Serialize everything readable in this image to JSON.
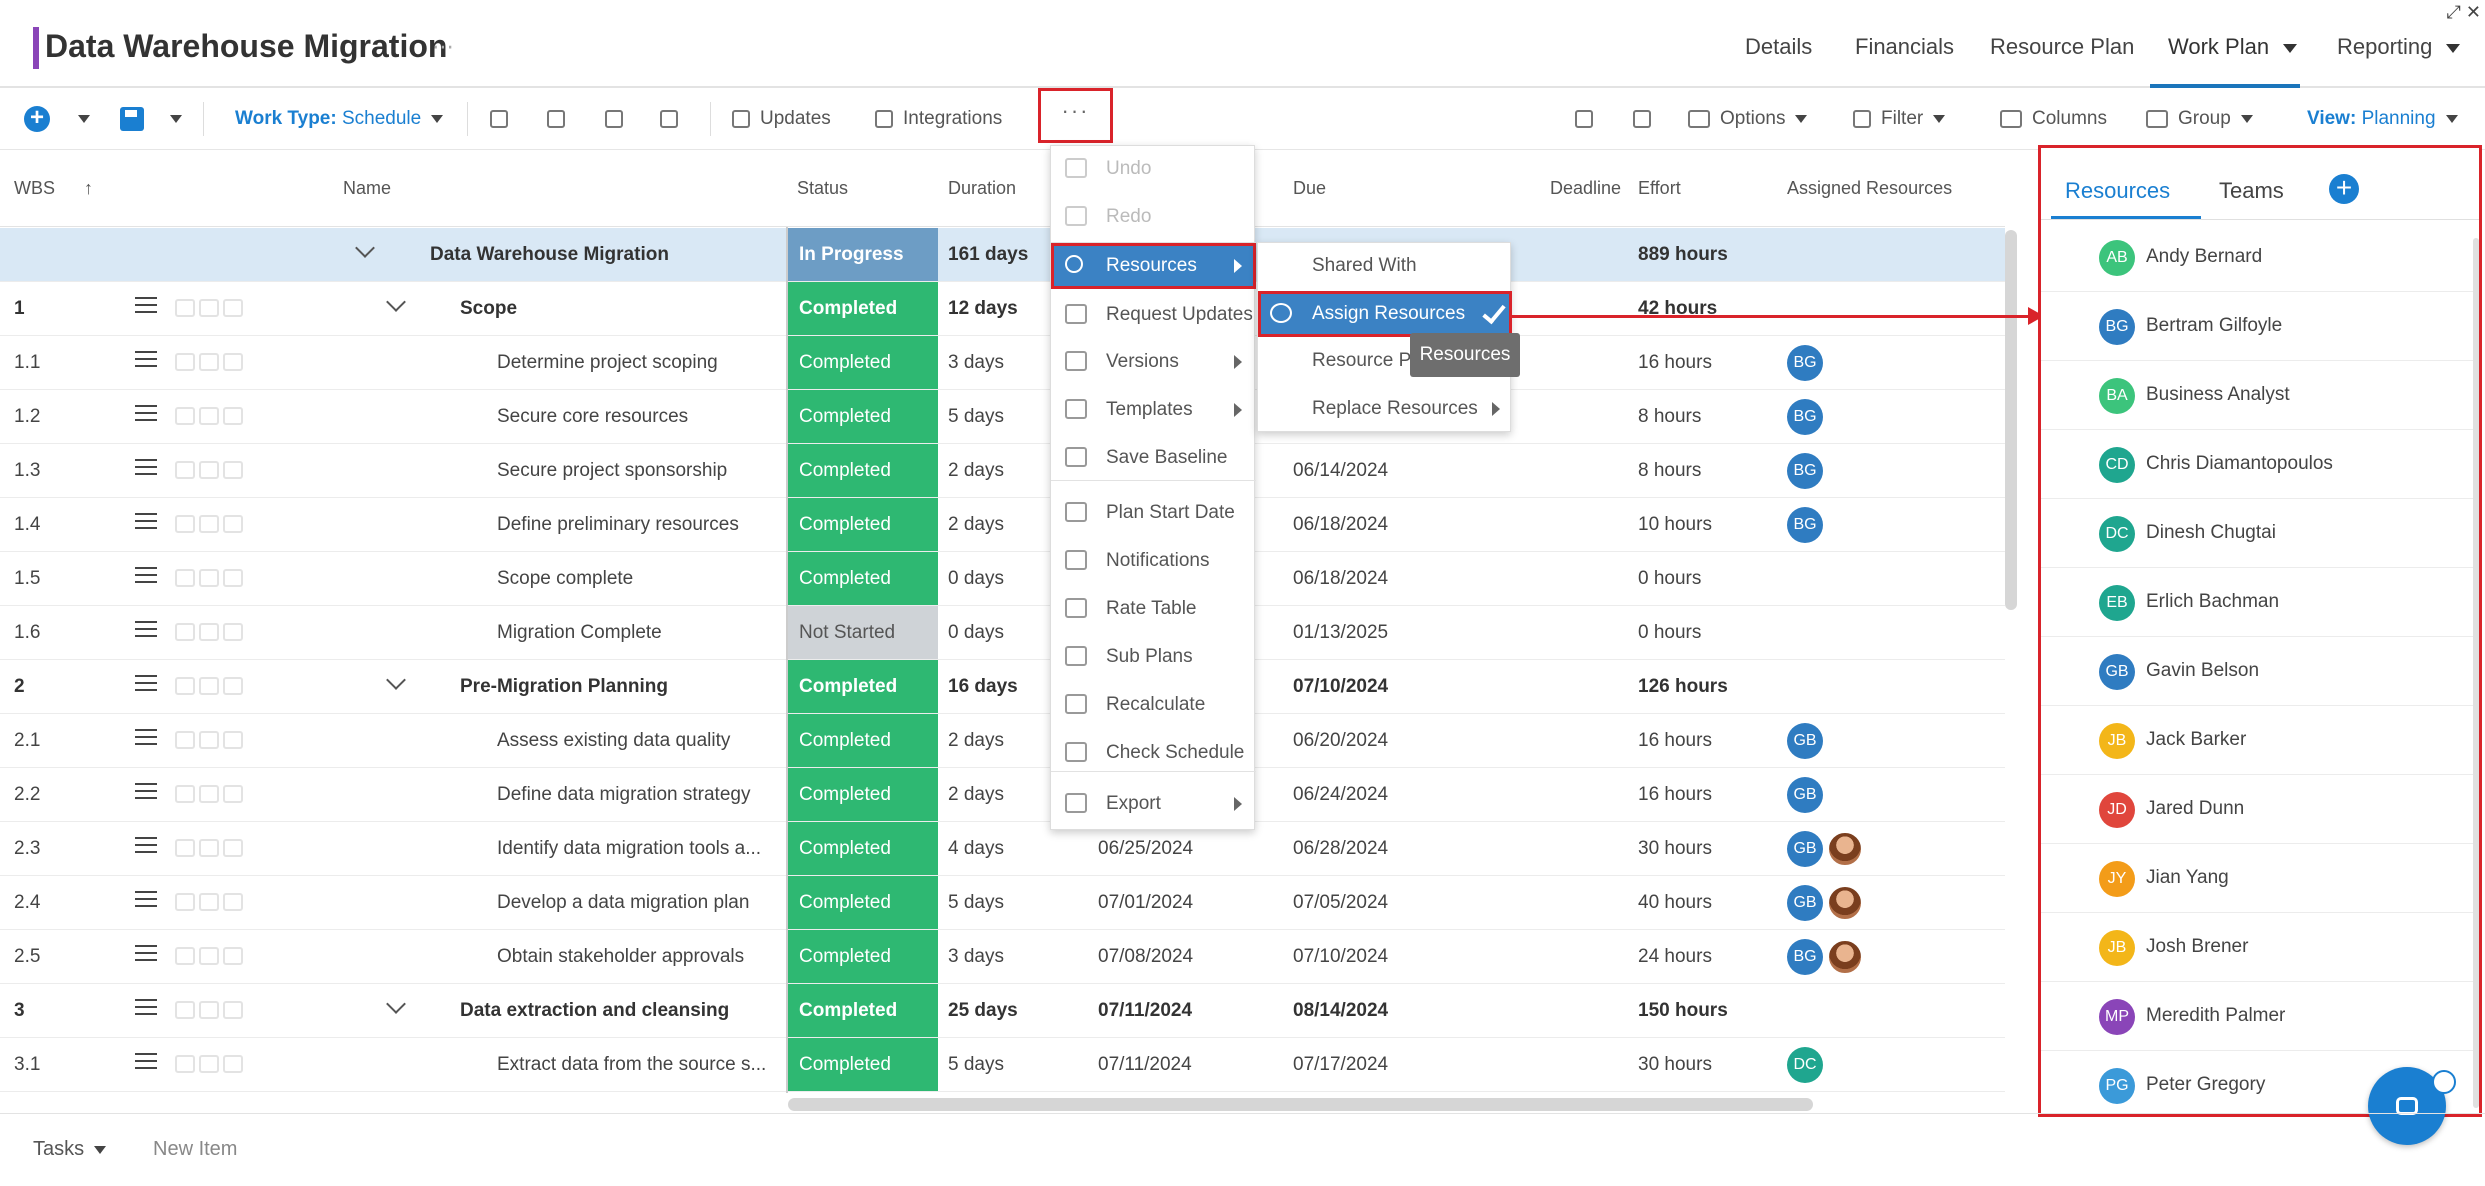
{
  "header": {
    "title": "Data Warehouse Migration",
    "title_more": "⋯",
    "nav": [
      {
        "label": "Details"
      },
      {
        "label": "Financials"
      },
      {
        "label": "Resource Plan"
      },
      {
        "label": "Work Plan"
      },
      {
        "label": "Reporting"
      }
    ],
    "active_nav": "Work Plan",
    "window_icons": "⤢ ✕"
  },
  "toolbar": {
    "work_type_label": "Work Type:",
    "work_type_value": "Schedule",
    "updates": "Updates",
    "integrations": "Integrations",
    "more": "···",
    "options": "Options",
    "filter": "Filter",
    "columns": "Columns",
    "group": "Group",
    "view_label": "View:",
    "view_value": "Planning"
  },
  "grid": {
    "headers": {
      "wbs": "WBS",
      "name": "Name",
      "status": "Status",
      "duration": "Duration",
      "due": "Due",
      "deadline": "Deadline",
      "effort": "Effort",
      "assigned": "Assigned Resources"
    },
    "rows": [
      {
        "wbs": "",
        "name": "Data Warehouse Migration",
        "status": "In Progress",
        "duration": "161 days",
        "start": "",
        "due": "",
        "effort": "889 hours",
        "avatars": []
      },
      {
        "wbs": "1",
        "name": "Scope",
        "status": "Completed",
        "duration": "12 days",
        "start": "",
        "due": "",
        "effort": "42 hours",
        "avatars": []
      },
      {
        "wbs": "1.1",
        "name": "Determine project scoping",
        "status": "Completed",
        "duration": "3 days",
        "start": "",
        "due": "",
        "effort": "16 hours",
        "avatars": [
          "BG"
        ]
      },
      {
        "wbs": "1.2",
        "name": "Secure core resources",
        "status": "Completed",
        "duration": "5 days",
        "start": "",
        "due": "",
        "effort": "8 hours",
        "avatars": [
          "BG"
        ]
      },
      {
        "wbs": "1.3",
        "name": "Secure project sponsorship",
        "status": "Completed",
        "duration": "2 days",
        "start": "",
        "due": "06/14/2024",
        "effort": "8 hours",
        "avatars": [
          "BG"
        ]
      },
      {
        "wbs": "1.4",
        "name": "Define preliminary resources",
        "status": "Completed",
        "duration": "2 days",
        "start": "",
        "due": "06/18/2024",
        "effort": "10 hours",
        "avatars": [
          "BG"
        ]
      },
      {
        "wbs": "1.5",
        "name": "Scope complete",
        "status": "Completed",
        "duration": "0 days",
        "start": "",
        "due": "06/18/2024",
        "effort": "0 hours",
        "avatars": []
      },
      {
        "wbs": "1.6",
        "name": "Migration Complete",
        "status": "Not Started",
        "duration": "0 days",
        "start": "",
        "due": "01/13/2025",
        "effort": "0 hours",
        "avatars": []
      },
      {
        "wbs": "2",
        "name": "Pre-Migration Planning",
        "status": "Completed",
        "duration": "16 days",
        "start": "",
        "due": "07/10/2024",
        "effort": "126 hours",
        "avatars": []
      },
      {
        "wbs": "2.1",
        "name": "Assess existing data quality",
        "status": "Completed",
        "duration": "2 days",
        "start": "",
        "due": "06/20/2024",
        "effort": "16 hours",
        "avatars": [
          "GB"
        ]
      },
      {
        "wbs": "2.2",
        "name": "Define data migration strategy",
        "status": "Completed",
        "duration": "2 days",
        "start": "",
        "due": "06/24/2024",
        "effort": "16 hours",
        "avatars": [
          "GB"
        ]
      },
      {
        "wbs": "2.3",
        "name": "Identify data migration tools a...",
        "status": "Completed",
        "duration": "4 days",
        "start": "06/25/2024",
        "due": "06/28/2024",
        "effort": "30 hours",
        "avatars": [
          "GB",
          "photo"
        ]
      },
      {
        "wbs": "2.4",
        "name": "Develop a data migration plan",
        "status": "Completed",
        "duration": "5 days",
        "start": "07/01/2024",
        "due": "07/05/2024",
        "effort": "40 hours",
        "avatars": [
          "GB",
          "photo"
        ]
      },
      {
        "wbs": "2.5",
        "name": "Obtain stakeholder approvals",
        "status": "Completed",
        "duration": "3 days",
        "start": "07/08/2024",
        "due": "07/10/2024",
        "effort": "24 hours",
        "avatars": [
          "BG",
          "photo"
        ]
      },
      {
        "wbs": "3",
        "name": "Data extraction and cleansing",
        "status": "Completed",
        "duration": "25 days",
        "start": "07/11/2024",
        "due": "08/14/2024",
        "effort": "150 hours",
        "avatars": []
      },
      {
        "wbs": "3.1",
        "name": "Extract data from the source s...",
        "status": "Completed",
        "duration": "5 days",
        "start": "07/11/2024",
        "due": "07/17/2024",
        "effort": "30 hours",
        "avatars": [
          "DC"
        ]
      }
    ]
  },
  "menu": {
    "items": [
      {
        "label": "Undo",
        "disabled": true
      },
      {
        "label": "Redo",
        "disabled": true
      },
      {
        "label": "Resources",
        "submenu": true,
        "active": true
      },
      {
        "label": "Request Updates"
      },
      {
        "label": "Versions",
        "submenu": true
      },
      {
        "label": "Templates",
        "submenu": true
      },
      {
        "label": "Save Baseline"
      },
      {
        "label": "Plan Start Date"
      },
      {
        "label": "Notifications"
      },
      {
        "label": "Rate Table"
      },
      {
        "label": "Sub Plans"
      },
      {
        "label": "Recalculate"
      },
      {
        "label": "Check Schedule"
      },
      {
        "label": "Export",
        "submenu": true
      }
    ]
  },
  "submenu": {
    "items": [
      {
        "label": "Shared With"
      },
      {
        "label": "Assign Resources",
        "active": true,
        "checked": true
      },
      {
        "label": "Resource Pla"
      },
      {
        "label": "Replace Resources",
        "submenu": true
      }
    ],
    "tooltip": "Resources"
  },
  "panel": {
    "tabs": [
      {
        "label": "Resources"
      },
      {
        "label": "Teams"
      }
    ],
    "add": "+",
    "resources": [
      {
        "initials": "AB",
        "name": "Andy Bernard",
        "color": "#3cc47c"
      },
      {
        "initials": "BG",
        "name": "Bertram Gilfoyle",
        "color": "#2f7cc1"
      },
      {
        "initials": "BA",
        "name": "Business Analyst",
        "color": "#3cc47c"
      },
      {
        "initials": "CD",
        "name": "Chris Diamantopoulos",
        "color": "#1fa68f"
      },
      {
        "initials": "DC",
        "name": "Dinesh Chugtai",
        "color": "#1fa68f"
      },
      {
        "initials": "EB",
        "name": "Erlich Bachman",
        "color": "#1fa68f"
      },
      {
        "initials": "GB",
        "name": "Gavin Belson",
        "color": "#2f7cc1"
      },
      {
        "initials": "JB",
        "name": "Jack Barker",
        "color": "#f3b619"
      },
      {
        "initials": "JD",
        "name": "Jared Dunn",
        "color": "#e0463c"
      },
      {
        "initials": "JY",
        "name": "Jian Yang",
        "color": "#f39c19"
      },
      {
        "initials": "JB",
        "name": "Josh Brener",
        "color": "#f3b619"
      },
      {
        "initials": "MP",
        "name": "Meredith Palmer",
        "color": "#8a45b8"
      },
      {
        "initials": "PG",
        "name": "Peter Gregory",
        "color": "#3b9ad9"
      }
    ]
  },
  "footer": {
    "tasks": "Tasks",
    "new_item": "New Item"
  },
  "colors": {
    "accent": "#1a7fd1",
    "completed": "#2eb872",
    "in_progress": "#6d9dc5",
    "not_started": "#cfd3d7",
    "highlight": "#d9232a"
  }
}
